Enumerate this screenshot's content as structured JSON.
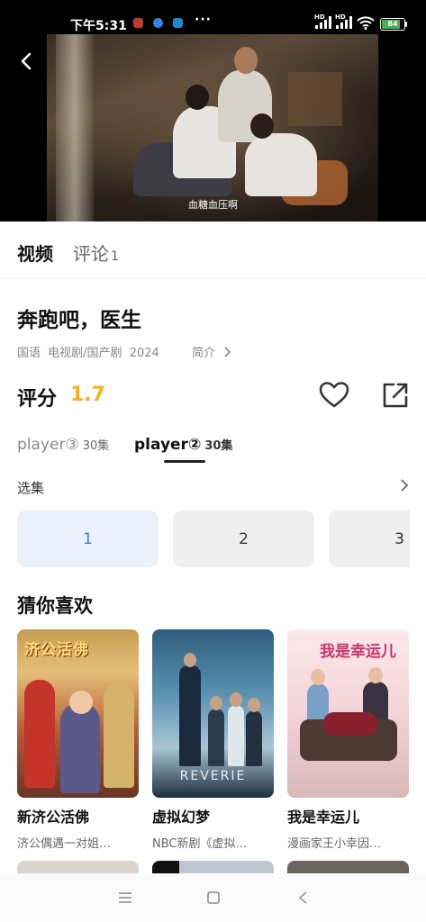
{
  "status_bar": {
    "time": "下午5:31",
    "dots": "···",
    "hd1": "HD",
    "hd2": "HD",
    "battery": "84",
    "battery_level": 0.84
  },
  "video": {
    "subtitle": "血糖血压啊"
  },
  "tabs": {
    "video": "视频",
    "comment": "评论",
    "comment_count": "1"
  },
  "show": {
    "title": "奔跑吧，医生",
    "meta": [
      "国语",
      "电视剧/国产剧",
      "2024"
    ],
    "intro_label": "简介",
    "rating_label": "评分",
    "rating_value": "1.7"
  },
  "players": [
    {
      "name": "player③",
      "episodes": "30集",
      "active": false
    },
    {
      "name": "player②",
      "episodes": "30集",
      "active": true
    }
  ],
  "episode_section": {
    "label": "选集",
    "episodes": [
      "1",
      "2",
      "3"
    ],
    "selected": "1"
  },
  "recommend": {
    "title": "猜你喜欢",
    "items": [
      {
        "title": "新济公活佛",
        "desc": "济公偶遇一对姐…",
        "poster_text": "济公活佛"
      },
      {
        "title": "虚拟幻梦",
        "desc": "NBC新剧《虚拟…",
        "poster_text": "REVERIE"
      },
      {
        "title": "我是幸运儿",
        "desc": "漫画家王小幸因…",
        "poster_text": "我是幸运儿"
      }
    ]
  },
  "colors": {
    "rating": "#f2b21c",
    "episode_active_bg": "#e9f1fc",
    "episode_active_text": "#4a7bd0"
  },
  "icons": {
    "back": "chevron-left-icon",
    "favorite": "heart-icon",
    "share": "share-icon",
    "intro_arrow": "chevron-right-icon",
    "nav_menu": "menu-icon",
    "nav_home": "home-square-icon",
    "nav_back": "back-triangle-icon"
  }
}
